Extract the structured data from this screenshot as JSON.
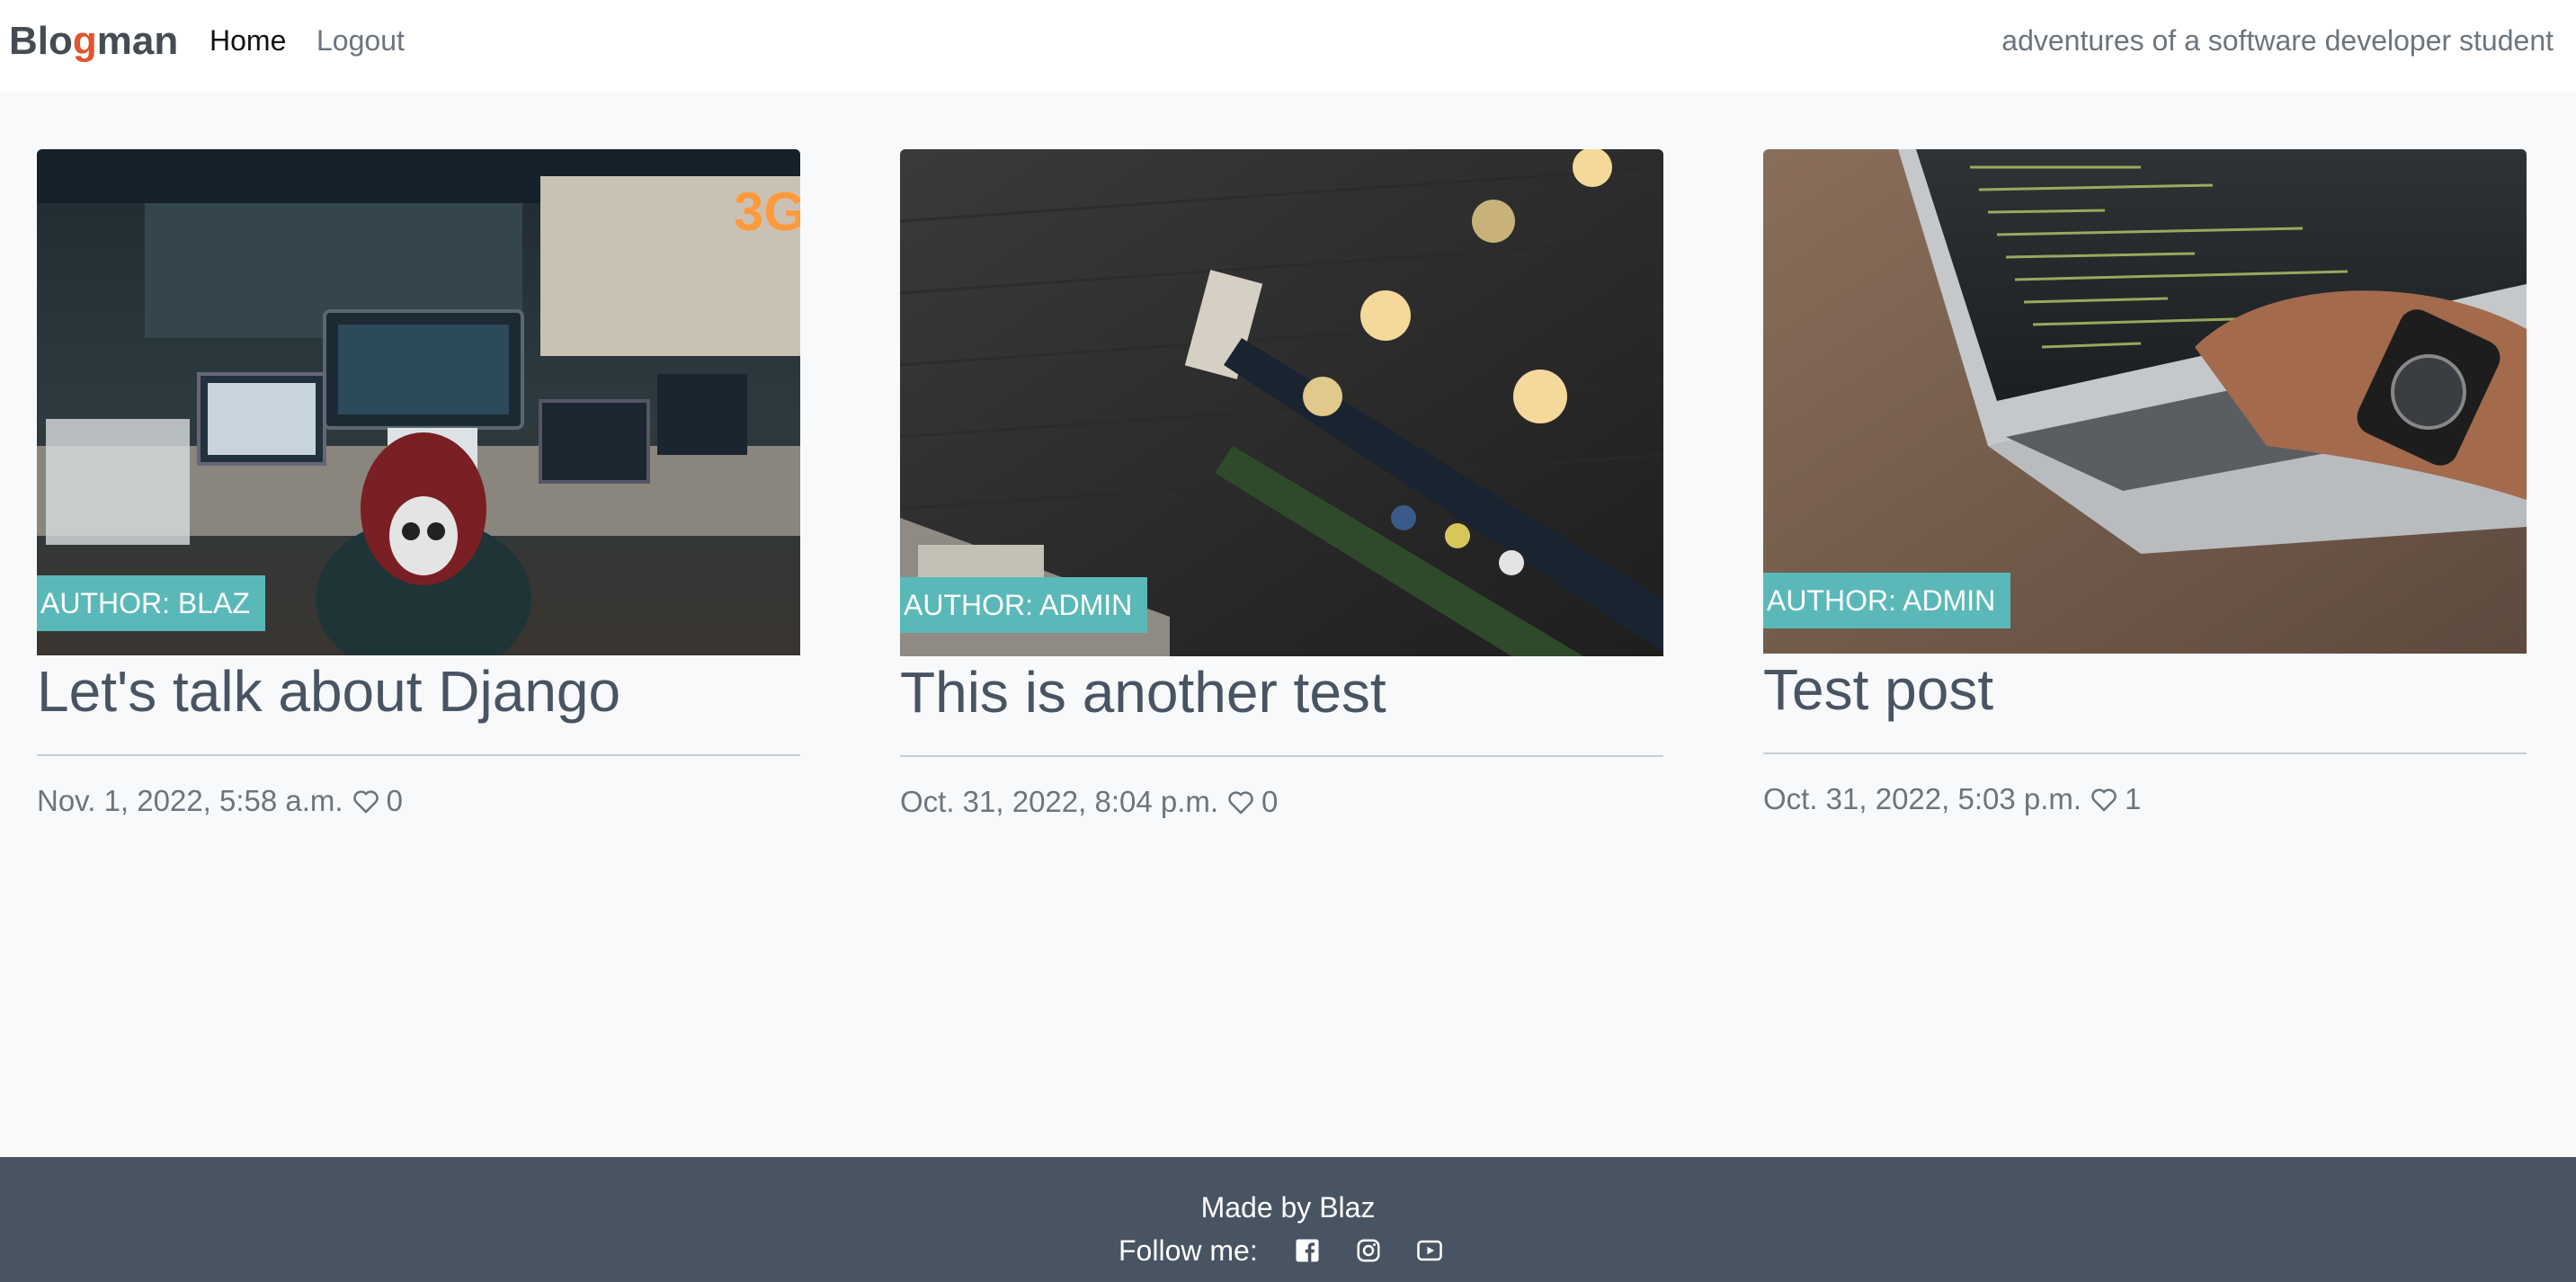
{
  "navbar": {
    "brand_prefix": "Blo",
    "brand_accent": "g",
    "brand_suffix": "man",
    "links": [
      {
        "label": "Home"
      },
      {
        "label": "Logout"
      }
    ],
    "tagline": "adventures of a software developer student"
  },
  "posts": [
    {
      "author": "AUTHOR: BLAZ",
      "title": "Let's talk about Django",
      "date": "Nov. 1, 2022, 5:58 a.m.",
      "likes": "0"
    },
    {
      "author": "AUTHOR: ADMIN",
      "title": "This is another test",
      "date": "Oct. 31, 2022, 8:04 p.m.",
      "likes": "0"
    },
    {
      "author": "AUTHOR: ADMIN",
      "title": "Test post",
      "date": "Oct. 31, 2022, 5:03 p.m.",
      "likes": "1"
    }
  ],
  "footer": {
    "made_by": "Made by Blaz",
    "follow_label": "Follow me:",
    "social_icons": [
      "facebook-icon",
      "instagram-icon",
      "youtube-icon"
    ]
  },
  "colors": {
    "brand_accent": "#e0542f",
    "badge": "#5ab9b8",
    "footer_bg": "#495463",
    "page_bg": "#f8f9fa"
  }
}
